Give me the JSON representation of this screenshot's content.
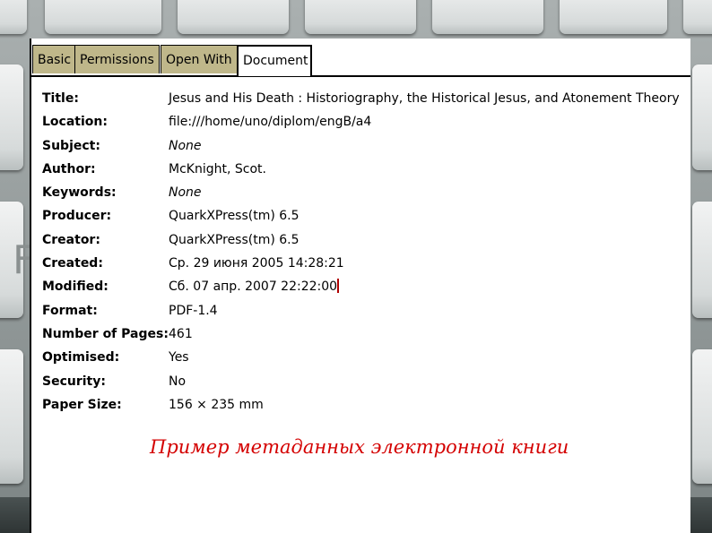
{
  "dialog": {
    "tabs": [
      {
        "label": "Basic"
      },
      {
        "label": "Permissions"
      },
      {
        "label": "Open With"
      },
      {
        "label": "Document"
      }
    ],
    "active_tab": "Document",
    "properties": [
      {
        "label": "Title:",
        "value": "Jesus and His Death : Historiography, the Historical Jesus, and Atonement Theory"
      },
      {
        "label": "Location:",
        "value": "file:///home/uno/diplom/engB/a4"
      },
      {
        "label": "Subject:",
        "value": "None"
      },
      {
        "label": "Author:",
        "value": "McKnight, Scot."
      },
      {
        "label": "Keywords:",
        "value": "None"
      },
      {
        "label": "Producer:",
        "value": "QuarkXPress(tm) 6.5"
      },
      {
        "label": "Creator:",
        "value": "QuarkXPress(tm) 6.5"
      },
      {
        "label": "Created:",
        "value": "Ср. 29 июня 2005 14:28:21"
      },
      {
        "label": "Modified:",
        "value": "Сб. 07 апр. 2007 22:22:00"
      },
      {
        "label": "Format:",
        "value": "PDF-1.4"
      },
      {
        "label": "Number of Pages:",
        "value": "461"
      },
      {
        "label": "Optimised:",
        "value": "Yes"
      },
      {
        "label": "Security:",
        "value": "No"
      },
      {
        "label": "Paper Size:",
        "value": "156 × 235 mm"
      }
    ]
  },
  "caption": "Пример метаданных электронной книги",
  "colors": {
    "tab_inactive": "#bfb78a",
    "caption": "#d40000",
    "cursor": "#b00000"
  }
}
